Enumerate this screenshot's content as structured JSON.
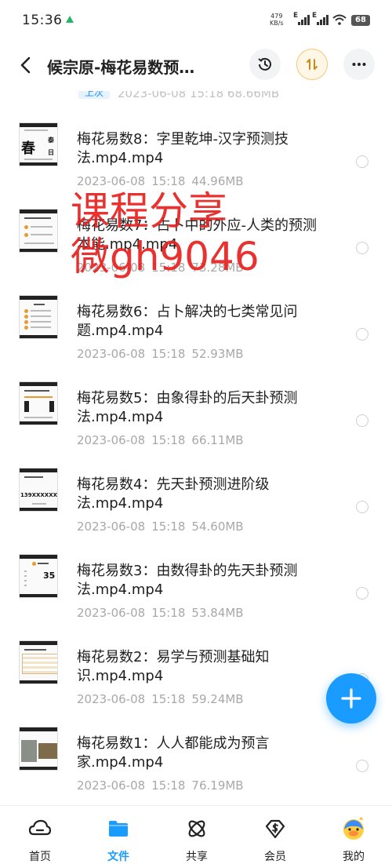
{
  "status_bar": {
    "time": "15:36",
    "net_speed": "479",
    "net_unit": "KB/s",
    "sig1_label": "E",
    "sig2_label": "E",
    "battery": "68"
  },
  "header": {
    "title": "候宗原-梅花易数预…"
  },
  "partial_row": {
    "tag": "上次",
    "meta": "2023-06-08 15:18 68.66MB"
  },
  "files": [
    {
      "name": "梅花易数8：字里乾坤-汉字预测技法.mp4.mp4",
      "date": "2023-06-08",
      "time": "15:18",
      "size": "44.96MB",
      "thumb_text": "春",
      "thumb_text2": "泰",
      "thumb_text3": "日"
    },
    {
      "name": "梅花易数7：占卜中的外应-人类的预测本能.mp4.mp4",
      "date": "2023-06-08",
      "time": "15:18",
      "size": "73.28MB"
    },
    {
      "name": "梅花易数6：占卜解决的七类常见问题.mp4.mp4",
      "date": "2023-06-08",
      "time": "15:18",
      "size": "52.93MB"
    },
    {
      "name": "梅花易数5：由象得卦的后天卦预测法.mp4.mp4",
      "date": "2023-06-08",
      "time": "15:18",
      "size": "66.11MB"
    },
    {
      "name": "梅花易数4：先天卦预测进阶级法.mp4.mp4",
      "date": "2023-06-08",
      "time": "15:18",
      "size": "54.60MB",
      "thumb_text": "139XXXXXXXX"
    },
    {
      "name": "梅花易数3：由数得卦的先天卦预测法.mp4.mp4",
      "date": "2023-06-08",
      "time": "15:18",
      "size": "53.84MB",
      "thumb_text": "35"
    },
    {
      "name": "梅花易数2：易学与预测基础知识.mp4.mp4",
      "date": "2023-06-08",
      "time": "15:18",
      "size": "59.24MB"
    },
    {
      "name": "梅花易数1：人人都能成为预言家.mp4.mp4",
      "date": "2023-06-08",
      "time": "15:18",
      "size": "76.19MB"
    }
  ],
  "watermark": {
    "line1": "课程分享",
    "line2": "微gh9046"
  },
  "tabbar": {
    "tabs": [
      {
        "label": "首页",
        "icon": "home-cloud-icon"
      },
      {
        "label": "文件",
        "icon": "folder-icon",
        "active": true
      },
      {
        "label": "共享",
        "icon": "share-orbit-icon"
      },
      {
        "label": "会员",
        "icon": "vip-dollar-icon"
      },
      {
        "label": "我的",
        "icon": "avatar-icon"
      }
    ]
  },
  "colors": {
    "accent": "#1a9bff",
    "watermark": "#e8201e",
    "meta_gray": "#a8a8a8"
  }
}
